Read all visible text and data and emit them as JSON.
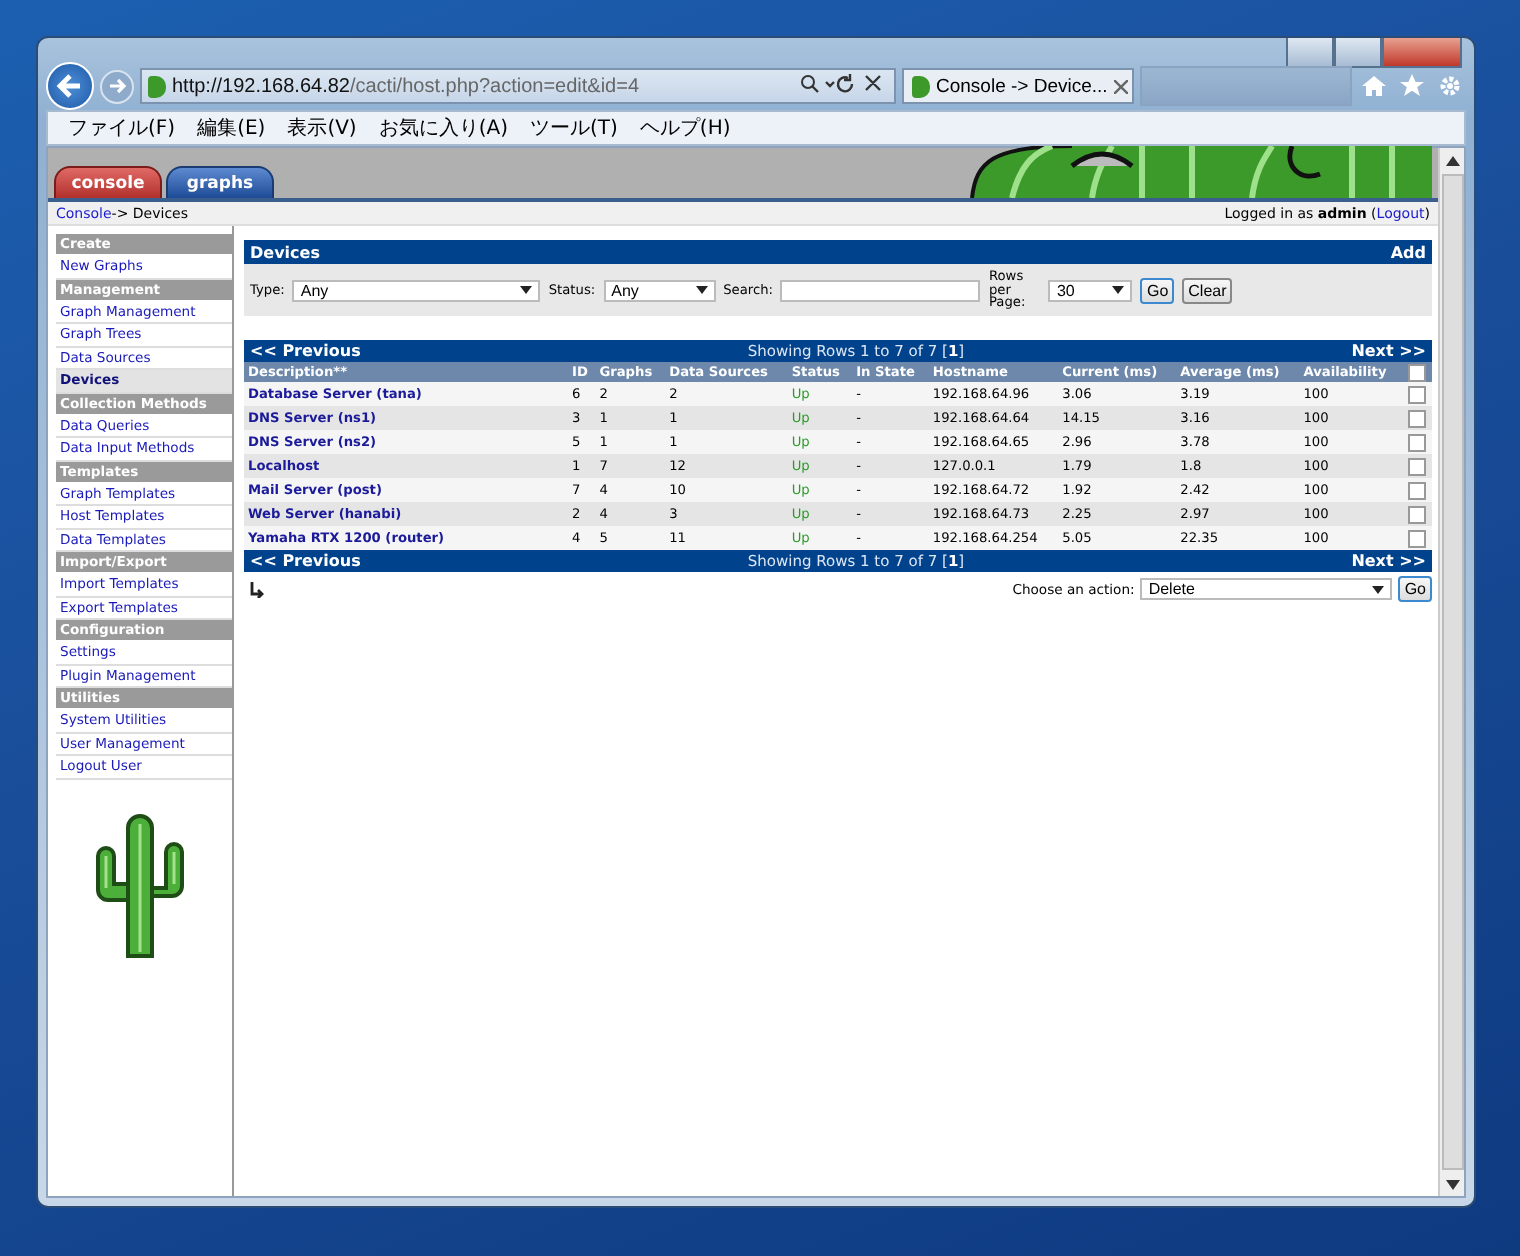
{
  "browser": {
    "address_host": "http://192.168.64.82",
    "address_path": "/cacti/host.php?action=edit&id=4",
    "tab_title": "Console -> Device...",
    "menu": [
      "ファイル(F)",
      "編集(E)",
      "表示(V)",
      "お気に入り(A)",
      "ツール(T)",
      "ヘルプ(H)"
    ]
  },
  "header_tabs": [
    {
      "label": "console",
      "selected": true
    },
    {
      "label": "graphs",
      "selected": false
    }
  ],
  "breadcrumb": {
    "link": "Console",
    "rest": "-> Devices"
  },
  "login": {
    "prefix": "Logged in as",
    "user": "admin",
    "paren_open": "(",
    "logout": "Logout",
    "paren_close": ")"
  },
  "sidebar": [
    {
      "heading": "Create",
      "items": [
        {
          "label": "New Graphs",
          "selected": false
        }
      ]
    },
    {
      "heading": "Management",
      "items": [
        {
          "label": "Graph Management",
          "selected": false
        },
        {
          "label": "Graph Trees",
          "selected": false
        },
        {
          "label": "Data Sources",
          "selected": false
        },
        {
          "label": "Devices",
          "selected": true
        }
      ]
    },
    {
      "heading": "Collection Methods",
      "items": [
        {
          "label": "Data Queries",
          "selected": false
        },
        {
          "label": "Data Input Methods",
          "selected": false
        }
      ]
    },
    {
      "heading": "Templates",
      "items": [
        {
          "label": "Graph Templates",
          "selected": false
        },
        {
          "label": "Host Templates",
          "selected": false
        },
        {
          "label": "Data Templates",
          "selected": false
        }
      ]
    },
    {
      "heading": "Import/Export",
      "items": [
        {
          "label": "Import Templates",
          "selected": false
        },
        {
          "label": "Export Templates",
          "selected": false
        }
      ]
    },
    {
      "heading": "Configuration",
      "items": [
        {
          "label": "Settings",
          "selected": false
        },
        {
          "label": "Plugin Management",
          "selected": false
        }
      ]
    },
    {
      "heading": "Utilities",
      "items": [
        {
          "label": "System Utilities",
          "selected": false
        },
        {
          "label": "User Management",
          "selected": false
        },
        {
          "label": "Logout User",
          "selected": false
        }
      ]
    }
  ],
  "devices": {
    "title": "Devices",
    "add": "Add",
    "filters": {
      "type_label": "Type:",
      "type_value": "Any",
      "status_label": "Status:",
      "status_value": "Any",
      "search_label": "Search:",
      "rows_label": "Rows per Page:",
      "rows_value": "30",
      "go": "Go",
      "clear": "Clear"
    },
    "navs": [
      {
        "previous": "<< Previous",
        "showing": "Showing Rows 1 to 7 of 7 [",
        "page": "1",
        "showing_end": "]",
        "next": "Next >>"
      },
      {
        "previous": "<< Previous",
        "showing": "Showing Rows 1 to 7 of 7 [",
        "page": "1",
        "showing_end": "]",
        "next": "Next >>"
      }
    ],
    "columns": [
      "Description**",
      "ID",
      "Graphs",
      "Data Sources",
      "Status",
      "In State",
      "Hostname",
      "Current (ms)",
      "Average (ms)",
      "Availability"
    ],
    "select_all_checked": false,
    "rows": [
      {
        "cells": [
          "Database Server (tana)",
          "6",
          "2",
          "2",
          "Up",
          "-",
          "192.168.64.96",
          "3.06",
          "3.19",
          "100"
        ],
        "checked": false
      },
      {
        "cells": [
          "DNS Server (ns1)",
          "3",
          "1",
          "1",
          "Up",
          "-",
          "192.168.64.64",
          "14.15",
          "3.16",
          "100"
        ],
        "checked": false
      },
      {
        "cells": [
          "DNS Server (ns2)",
          "5",
          "1",
          "1",
          "Up",
          "-",
          "192.168.64.65",
          "2.96",
          "3.78",
          "100"
        ],
        "checked": false
      },
      {
        "cells": [
          "Localhost",
          "1",
          "7",
          "12",
          "Up",
          "-",
          "127.0.0.1",
          "1.79",
          "1.8",
          "100"
        ],
        "checked": false
      },
      {
        "cells": [
          "Mail Server (post)",
          "7",
          "4",
          "10",
          "Up",
          "-",
          "192.168.64.72",
          "1.92",
          "2.42",
          "100"
        ],
        "checked": false
      },
      {
        "cells": [
          "Web Server (hanabi)",
          "2",
          "4",
          "3",
          "Up",
          "-",
          "192.168.64.73",
          "2.25",
          "2.97",
          "100"
        ],
        "checked": false
      },
      {
        "cells": [
          "Yamaha RTX 1200 (router)",
          "4",
          "5",
          "11",
          "Up",
          "-",
          "192.168.64.254",
          "5.05",
          "22.35",
          "100"
        ],
        "checked": false
      }
    ],
    "action": {
      "label": "Choose an action:",
      "value": "Delete",
      "go": "Go"
    }
  }
}
